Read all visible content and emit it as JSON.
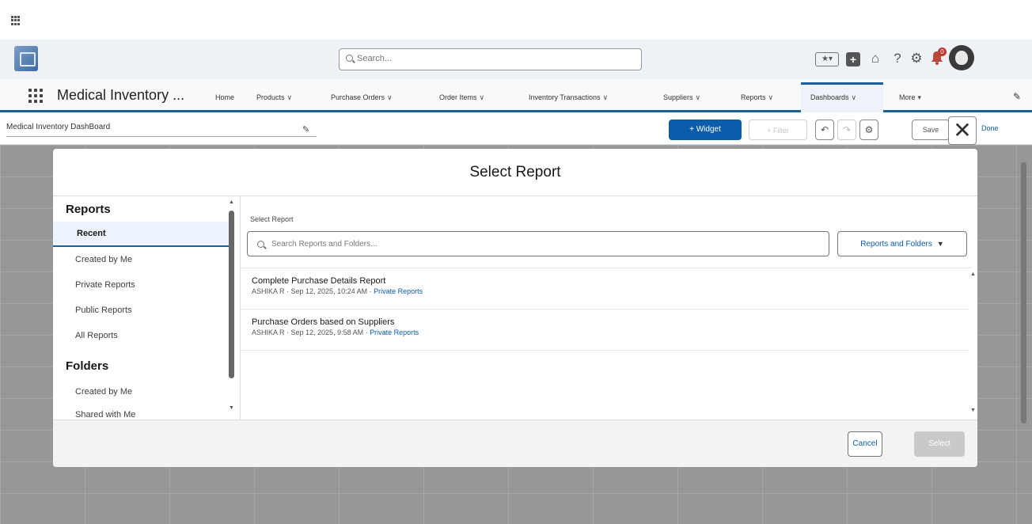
{
  "header": {
    "search_placeholder": "Search...",
    "favorites_icon": "★▾",
    "add_icon": "+",
    "trailhead_icon": "⌂",
    "help_icon": "?",
    "settings_icon": "⚙",
    "notification_count": "0"
  },
  "nav": {
    "app_name": "Medical Inventory ...",
    "items": [
      "Home",
      "Products",
      "Purchase Orders",
      "Order Items",
      "Inventory Transactions",
      "Suppliers",
      "Reports",
      "Dashboards",
      "More"
    ]
  },
  "toolbar": {
    "dashboard_name": "Medical Inventory DashBoard",
    "widget_label": "+ Widget",
    "filter_label": "+ Filter",
    "save_label": "Save",
    "done_label": "Done"
  },
  "modal": {
    "title": "Select Report",
    "sidebar": {
      "reports_heading": "Reports",
      "report_items": [
        "Recent",
        "Created by Me",
        "Private Reports",
        "Public Reports",
        "All Reports"
      ],
      "folders_heading": "Folders",
      "folder_items": [
        "Created by Me",
        "Shared with Me"
      ]
    },
    "select_label": "Select Report",
    "search_placeholder": "Search Reports and Folders...",
    "filter_dropdown": "Reports and Folders",
    "reports": [
      {
        "title": "Complete Purchase Details Report",
        "owner": "ASHIKA R",
        "date": "Sep 12, 2025, 10:24 AM",
        "folder": "Private Reports"
      },
      {
        "title": "Purchase Orders based on Suppliers",
        "owner": "ASHIKA R",
        "date": "Sep 12, 2025, 9:58 AM",
        "folder": "Private Reports"
      }
    ],
    "cancel_label": "Cancel",
    "select_button": "Select"
  },
  "colors": {
    "brand_blue": "#0b5cab",
    "nav_accent": "#1b5f9e"
  }
}
